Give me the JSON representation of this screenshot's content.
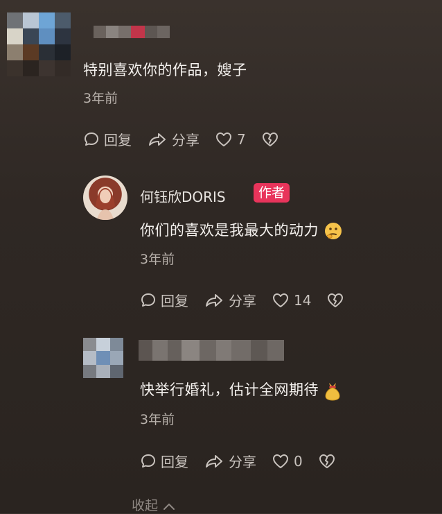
{
  "comments": [
    {
      "text": "特别喜欢你的作品，嫂子",
      "time": "3年前",
      "reply_label": "回复",
      "share_label": "分享",
      "likes": "7"
    }
  ],
  "replies": [
    {
      "author": "何钰欣DORIS",
      "badge": "作者",
      "text": "你们的喜欢是我最大的动力",
      "emoji": "thinking-face-icon",
      "time": "3年前",
      "reply_label": "回复",
      "share_label": "分享",
      "likes": "14"
    },
    {
      "text": "快举行婚礼，估计全网期待",
      "emoji": "money-bag-icon",
      "time": "3年前",
      "reply_label": "回复",
      "share_label": "分享",
      "likes": "0"
    }
  ],
  "collapse_label": "收起",
  "colors": {
    "badge": "#e8345b",
    "background": "#2f2824",
    "secondary_text": "#b9b2ac"
  }
}
